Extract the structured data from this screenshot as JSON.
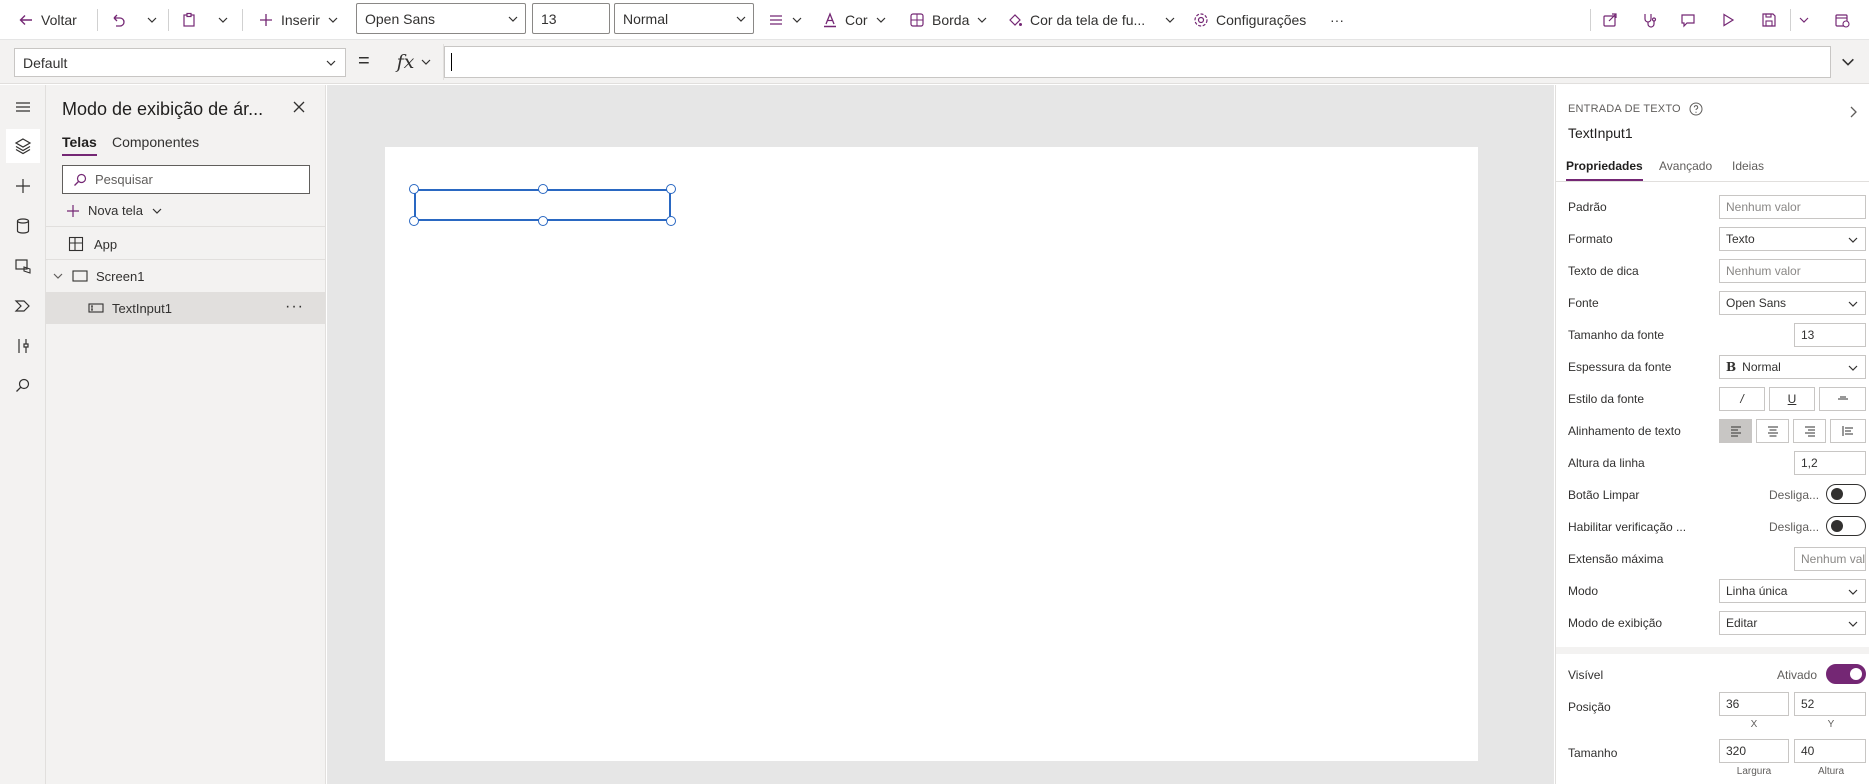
{
  "toolbar": {
    "back_label": "Voltar",
    "insert_label": "Inserir",
    "font_value": "Open Sans",
    "font_size_value": "13",
    "font_weight_value": "Normal",
    "color_label": "Cor",
    "border_label": "Borda",
    "fill_label": "Cor da tela de fu...",
    "settings_label": "Configurações",
    "more_label": "···"
  },
  "formula": {
    "property_value": "Default",
    "equals": "=",
    "fx_label": "fx",
    "value": ""
  },
  "tree": {
    "title": "Modo de exibição de ár...",
    "tabs": [
      "Telas",
      "Componentes"
    ],
    "search_placeholder": "Pesquisar",
    "new_screen_label": "Nova tela",
    "items": [
      {
        "label": "App"
      },
      {
        "label": "Screen1"
      },
      {
        "label": "TextInput1"
      }
    ],
    "row_more": "···"
  },
  "properties": {
    "control_type": "ENTRADA DE TEXTO",
    "control_name": "TextInput1",
    "tabs": [
      "Propriedades",
      "Avançado",
      "Ideias"
    ],
    "rows": {
      "default": {
        "label": "Padrão",
        "placeholder": "Nenhum valor"
      },
      "format": {
        "label": "Formato",
        "value": "Texto"
      },
      "hint": {
        "label": "Texto de dica",
        "placeholder": "Nenhum valor"
      },
      "font": {
        "label": "Fonte",
        "value": "Open Sans"
      },
      "font_size": {
        "label": "Tamanho da fonte",
        "value": "13"
      },
      "font_weight": {
        "label": "Espessura da fonte",
        "value": "Normal",
        "bold_glyph": "B"
      },
      "font_style": {
        "label": "Estilo da fonte",
        "italic": "/",
        "underline": "U"
      },
      "text_align": {
        "label": "Alinhamento de texto"
      },
      "line_height": {
        "label": "Altura da linha",
        "value": "1,2"
      },
      "clear_button": {
        "label": "Botão Limpar",
        "state": "Desliga..."
      },
      "spellcheck": {
        "label": "Habilitar verificação ...",
        "state": "Desliga..."
      },
      "max_length": {
        "label": "Extensão máxima",
        "placeholder": "Nenhum val"
      },
      "mode": {
        "label": "Modo",
        "value": "Linha única"
      },
      "display_mode": {
        "label": "Modo de exibição",
        "value": "Editar"
      },
      "visible": {
        "label": "Visível",
        "state": "Ativado"
      },
      "position": {
        "label": "Posição",
        "x": "36",
        "y": "52",
        "x_caption": "X",
        "y_caption": "Y"
      },
      "size": {
        "label": "Tamanho",
        "width": "320",
        "height": "40",
        "width_caption": "Largura",
        "height_caption": "Altura"
      }
    }
  },
  "colors": {
    "accent": "#742774",
    "selection": "#2a68c2"
  }
}
